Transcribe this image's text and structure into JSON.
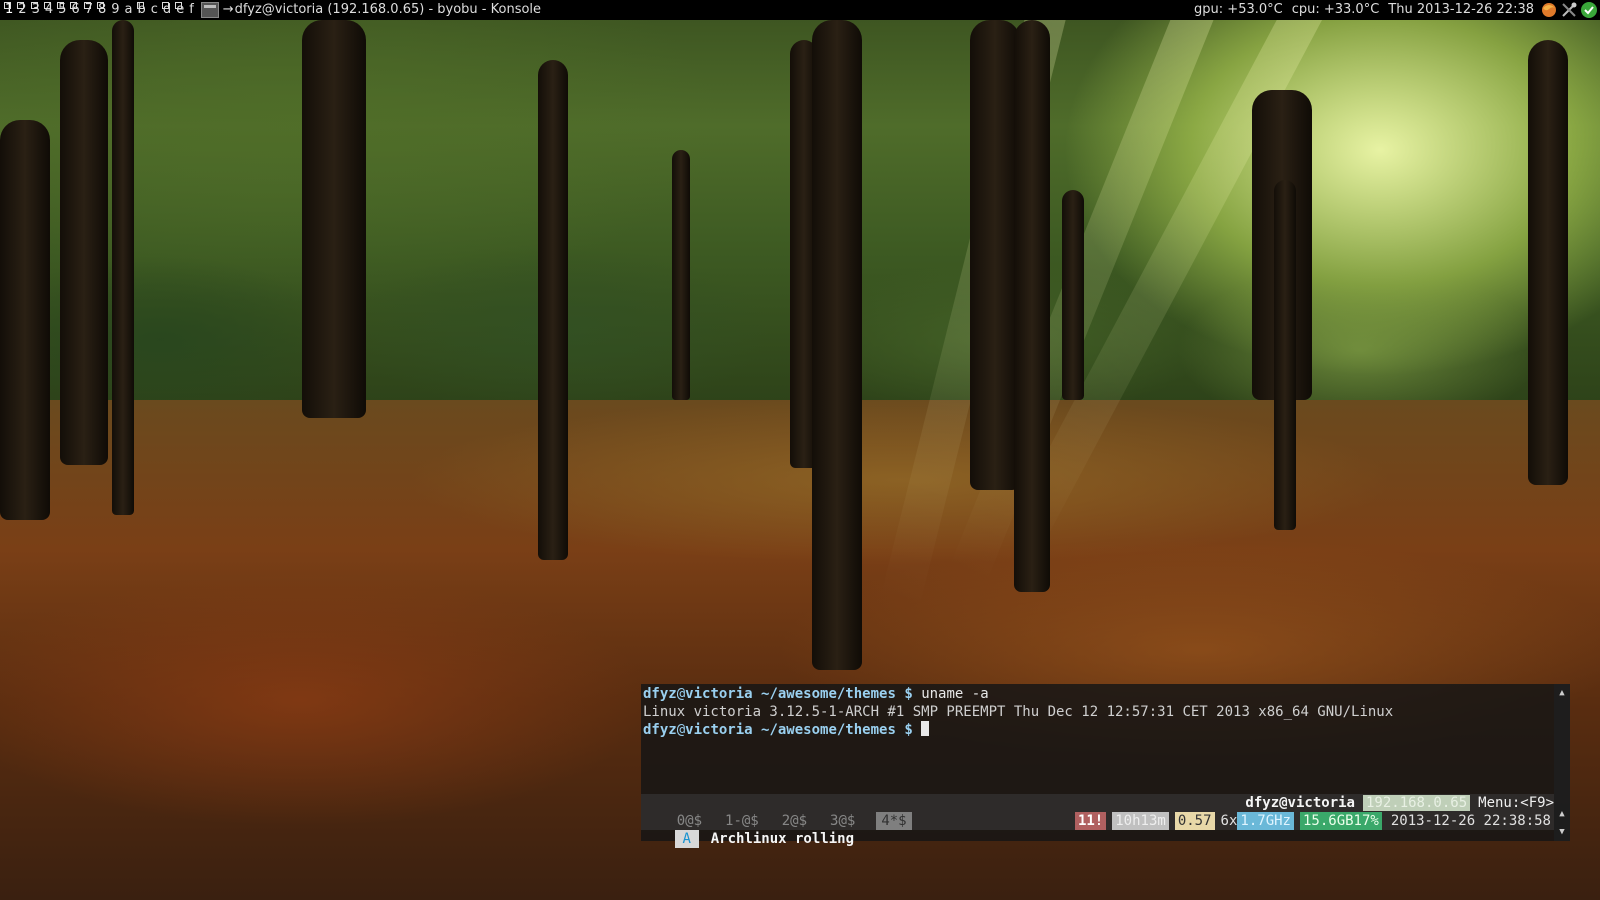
{
  "top_panel": {
    "tags": [
      {
        "label": "1",
        "occupied": true,
        "focused": true
      },
      {
        "label": "2",
        "occupied": true
      },
      {
        "label": "3",
        "occupied": true
      },
      {
        "label": "4",
        "occupied": true
      },
      {
        "label": "5",
        "occupied": true
      },
      {
        "label": "6",
        "occupied": true
      },
      {
        "label": "7",
        "occupied": true
      },
      {
        "label": "8",
        "occupied": true
      },
      {
        "label": "9",
        "occupied": false
      },
      {
        "label": "a",
        "occupied": false
      },
      {
        "label": "b",
        "occupied": true
      },
      {
        "label": "c",
        "occupied": false
      },
      {
        "label": "d",
        "occupied": true
      },
      {
        "label": "e",
        "occupied": true
      },
      {
        "label": "f",
        "occupied": false
      }
    ],
    "focus_mark": "→",
    "window_title": "dfyz@victoria (192.168.0.65) - byobu - Konsole",
    "gpu": "gpu: +53.0°C",
    "cpu": "cpu: +33.0°C",
    "clock": "Thu 2013-12-26 22:38",
    "tray_icons": [
      "firefox-icon",
      "network-tools-icon",
      "checkmark-icon"
    ]
  },
  "terminal": {
    "prompt_user": "dfyz",
    "prompt_at": "@",
    "prompt_host": "victoria",
    "prompt_path": " ~/awesome/themes",
    "prompt_dollar": " $ ",
    "command": "uname -a",
    "output": "Linux victoria 3.12.5-1-ARCH #1 SMP PREEMPT Thu Dec 12 12:57:31 CET 2013 x86_64 GNU/Linux"
  },
  "byobu": {
    "windows": [
      {
        "label": "0@$",
        "active": false
      },
      {
        "label": "1-@$",
        "active": false
      },
      {
        "label": "2@$",
        "active": false
      },
      {
        "label": "3@$",
        "active": false
      },
      {
        "label": "4*$",
        "active": true
      }
    ],
    "user_host": "dfyz@victoria",
    "ip": "192.168.0.65",
    "menu": "Menu:<F9>",
    "logo": "A",
    "distro": "Archlinux rolling",
    "updates": "11!",
    "uptime": "10h13m",
    "load": "0.57",
    "cpu_count": "6x",
    "cpu_freq": "1.7GHz",
    "mem": "15.6GB17%",
    "datetime": "2013-12-26 22:38:58"
  },
  "colors": {
    "prompt": "#9ad0f0",
    "freq_bg": "#6ab8d8",
    "mem_bg": "#3aa86a",
    "updates_bg": "#b06060",
    "load_bg": "#e8d8a8"
  }
}
